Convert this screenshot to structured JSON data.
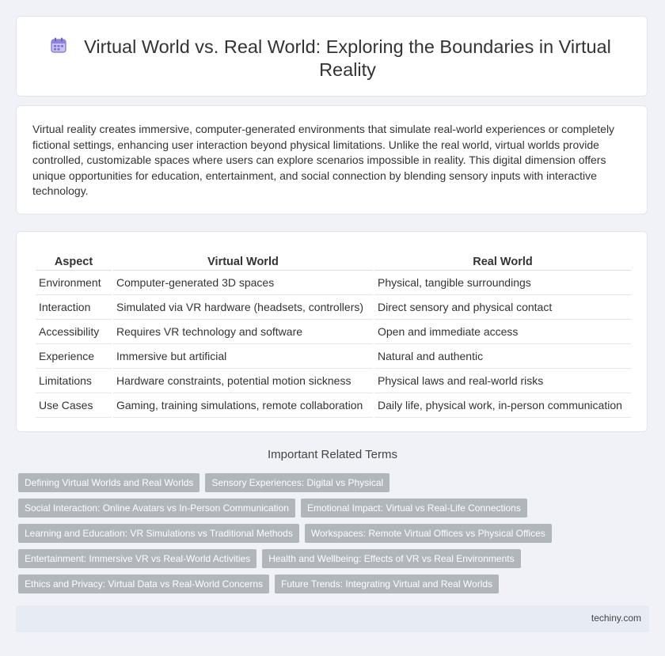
{
  "header": {
    "icon": "calendar-icon",
    "title": "Virtual World vs. Real World: Exploring the Boundaries in Virtual Reality"
  },
  "intro": {
    "text": "Virtual reality creates immersive, computer-generated environments that simulate real-world experiences or completely fictional settings, enhancing user interaction beyond physical limitations. Unlike the real world, virtual worlds provide controlled, customizable spaces where users can explore scenarios impossible in reality. This digital dimension offers unique opportunities for education, entertainment, and social connection by blending sensory inputs with interactive technology."
  },
  "table": {
    "headers": [
      "Aspect",
      "Virtual World",
      "Real World"
    ],
    "rows": [
      [
        "Environment",
        "Computer-generated 3D spaces",
        "Physical, tangible surroundings"
      ],
      [
        "Interaction",
        "Simulated via VR hardware (headsets, controllers)",
        "Direct sensory and physical contact"
      ],
      [
        "Accessibility",
        "Requires VR technology and software",
        "Open and immediate access"
      ],
      [
        "Experience",
        "Immersive but artificial",
        "Natural and authentic"
      ],
      [
        "Limitations",
        "Hardware constraints, potential motion sickness",
        "Physical laws and real-world risks"
      ],
      [
        "Use Cases",
        "Gaming, training simulations, remote collaboration",
        "Daily life, physical work, in-person communication"
      ]
    ]
  },
  "related": {
    "title": "Important Related Terms",
    "rows": [
      [
        "Defining Virtual Worlds and Real Worlds",
        "Sensory Experiences: Digital vs Physical"
      ],
      [
        "Social Interaction: Online Avatars vs In-Person Communication",
        "Emotional Impact: Virtual vs Real-Life Connections"
      ],
      [
        "Learning and Education: VR Simulations vs Traditional Methods",
        "Workspaces: Remote Virtual Offices vs Physical Offices"
      ],
      [
        "Entertainment: Immersive VR vs Real-World Activities",
        "Health and Wellbeing: Effects of VR vs Real Environments"
      ],
      [
        "Ethics and Privacy: Virtual Data vs Real-World Concerns",
        "Future Trends: Integrating Virtual and Real Worlds"
      ]
    ]
  },
  "footer": {
    "brand": "techiny.com"
  },
  "colors": {
    "page_bg": "#f0f2f7",
    "card_bg": "#ffffff",
    "tag_bg": "#b1b5bc",
    "footer_bg": "#e7ebf4",
    "icon_accent": "#7b6fd6"
  }
}
